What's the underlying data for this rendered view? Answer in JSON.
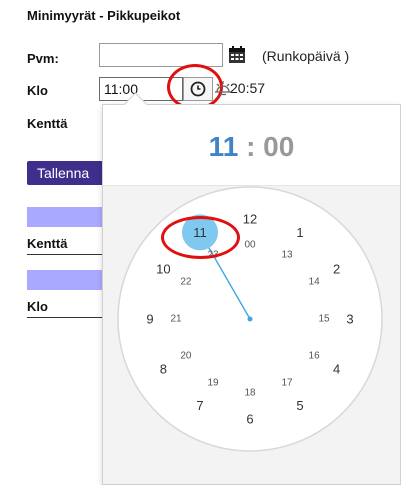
{
  "page": {
    "title": "Minimyyrät - Pikkupeikot"
  },
  "form": {
    "date_label": "Pvm:",
    "date_value": "",
    "runko_note": "(Runkopäivä )",
    "time_label": "Klo",
    "time_value": "11:00",
    "alt_time": "20:57",
    "field_label": "Kenttä",
    "save_label": "Tallenna",
    "list_field_label": "Kenttä",
    "list_time_label": "Klo"
  },
  "colors": {
    "accent": "#3f84c7",
    "button": "#3f2e8c",
    "band": "#a9a9ff",
    "highlight": "#e01010",
    "selected": "#7fc8f0"
  },
  "picker": {
    "hours": "11",
    "separator": ":",
    "minutes": "00",
    "outer_hours": [
      "12",
      "1",
      "2",
      "3",
      "4",
      "5",
      "6",
      "7",
      "8",
      "9",
      "10",
      "11"
    ],
    "inner_hours": [
      "00",
      "13",
      "14",
      "15",
      "16",
      "17",
      "18",
      "19",
      "20",
      "21",
      "22",
      "23"
    ],
    "selected_hour": "11"
  },
  "icons": {
    "calendar": "calendar-icon",
    "clock": "clock-icon",
    "sunrise": "sunrise-icon"
  }
}
